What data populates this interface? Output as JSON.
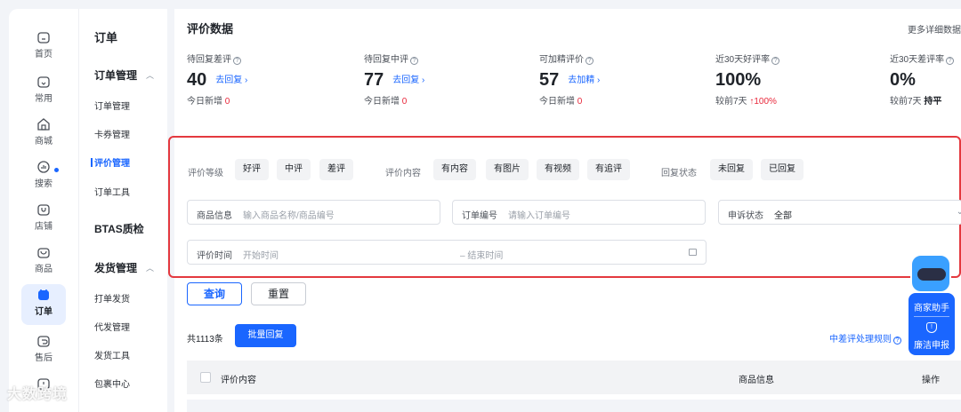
{
  "rail": {
    "items": [
      {
        "label": "首页",
        "icon": "home-icon"
      },
      {
        "label": "常用",
        "icon": "folder-icon"
      },
      {
        "label": "商城",
        "icon": "store-icon"
      },
      {
        "label": "搜索",
        "icon": "search-chart-icon"
      },
      {
        "label": "店铺",
        "icon": "shop-icon"
      },
      {
        "label": "商品",
        "icon": "bag-icon"
      },
      {
        "label": "订单",
        "icon": "order-icon"
      },
      {
        "label": "售后",
        "icon": "return-icon"
      },
      {
        "label": "",
        "icon": "clock-icon"
      }
    ]
  },
  "menu": {
    "title": "订单",
    "group1": "订单管理",
    "items1": [
      "订单管理",
      "卡券管理",
      "评价管理",
      "订单工具"
    ],
    "group2": "BTAS质检",
    "group3": "发货管理",
    "items3": [
      "打单发货",
      "代发管理",
      "发货工具",
      "包裹中心"
    ]
  },
  "page": {
    "title": "评价数据",
    "more": "更多详细数据"
  },
  "stats": [
    {
      "label": "待回复差评",
      "value": "40",
      "action": "去回复 ›",
      "sub_prefix": "今日新增",
      "sub_value": "0"
    },
    {
      "label": "待回复中评",
      "value": "77",
      "action": "去回复 ›",
      "sub_prefix": "今日新增",
      "sub_value": "0"
    },
    {
      "label": "可加精评价",
      "value": "57",
      "action": "去加精 ›",
      "sub_prefix": "今日新增",
      "sub_value": "0"
    },
    {
      "label": "近30天好评率",
      "value": "100%",
      "action": "",
      "sub_prefix": "较前7天",
      "sub_value": "↑100%"
    },
    {
      "label": "近30天差评率",
      "value": "0%",
      "action": "",
      "sub_prefix": "较前7天",
      "sub_value": "持平"
    }
  ],
  "filter": {
    "level_label": "评价等级",
    "levels": [
      "好评",
      "中评",
      "差评"
    ],
    "content_label": "评价内容",
    "contents": [
      "有内容",
      "有图片",
      "有视频",
      "有追评"
    ],
    "reply_label": "回复状态",
    "replies": [
      "未回复",
      "已回复"
    ],
    "product_label": "商品信息",
    "product_placeholder": "输入商品名称/商品编号",
    "order_label": "订单编号",
    "order_placeholder": "请输入订单编号",
    "appeal_label": "申诉状态",
    "appeal_value": "全部",
    "time_label": "评价时间",
    "time_start": "开始时间",
    "time_end": "– 结束时间"
  },
  "actions": {
    "query": "查询",
    "reset": "重置",
    "count": "共1113条",
    "batch_reply": "批量回复",
    "rules": "中差评处理规则"
  },
  "table": {
    "headers": [
      "评价内容",
      "商品信息",
      "操作"
    ]
  },
  "helper": {
    "assistant": "商家助手",
    "report": "廉洁申报"
  },
  "watermark": "大数跨境",
  "colors": {
    "accent": "#1a66ff",
    "danger": "#e8273a",
    "highlight_border": "#e4393f"
  }
}
